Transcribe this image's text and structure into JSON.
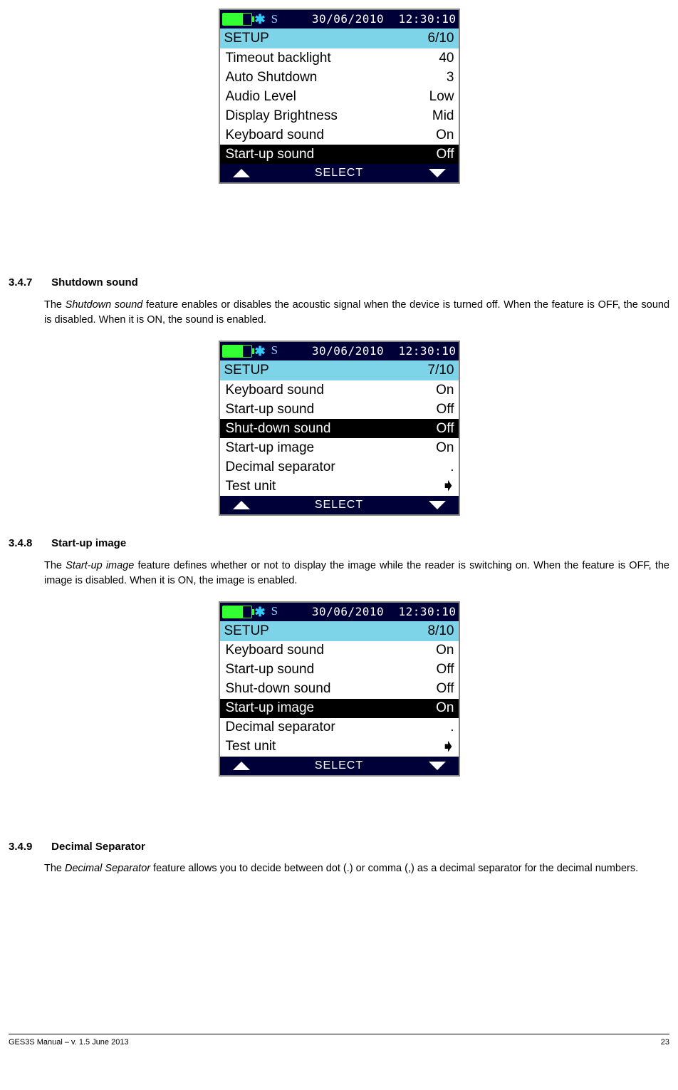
{
  "device_common": {
    "date": "30/06/2010",
    "time": "12:30:10",
    "setup_label": "SETUP",
    "select_label": "SELECT",
    "signal_letter": "S"
  },
  "screen1": {
    "page_indicator": "6/10",
    "rows": [
      {
        "label": "Timeout backlight",
        "value": "40",
        "selected": false
      },
      {
        "label": "Auto Shutdown",
        "value": "3",
        "selected": false
      },
      {
        "label": "Audio Level",
        "value": "Low",
        "selected": false
      },
      {
        "label": "Display Brightness",
        "value": "Mid",
        "selected": false
      },
      {
        "label": "Keyboard sound",
        "value": "On",
        "selected": false
      },
      {
        "label": "Start-up sound",
        "value": "Off",
        "selected": true
      }
    ]
  },
  "screen2": {
    "page_indicator": "7/10",
    "rows": [
      {
        "label": "Keyboard sound",
        "value": "On",
        "selected": false
      },
      {
        "label": "Start-up sound",
        "value": "Off",
        "selected": false
      },
      {
        "label": "Shut-down sound",
        "value": "Off",
        "selected": true
      },
      {
        "label": "Start-up image",
        "value": "On",
        "selected": false
      },
      {
        "label": "Decimal separator",
        "value": ".",
        "selected": false
      },
      {
        "label": "Test unit",
        "value": "➧",
        "selected": false,
        "arrow": true
      }
    ]
  },
  "screen3": {
    "page_indicator": "8/10",
    "rows": [
      {
        "label": "Keyboard sound",
        "value": "On",
        "selected": false
      },
      {
        "label": "Start-up sound",
        "value": "Off",
        "selected": false
      },
      {
        "label": "Shut-down sound",
        "value": "Off",
        "selected": false
      },
      {
        "label": "Start-up image",
        "value": "On",
        "selected": true
      },
      {
        "label": "Decimal separator",
        "value": ".",
        "selected": false
      },
      {
        "label": "Test unit",
        "value": "➧",
        "selected": false,
        "arrow": true
      }
    ]
  },
  "sections": {
    "s347": {
      "num": "3.4.7",
      "title": "Shutdown sound",
      "text_pre": "The ",
      "feat": "Shutdown sound",
      "text_post": " feature enables or disables the acoustic signal when the device is turned off. When the feature is OFF, the sound is disabled. When it is ON, the sound is enabled."
    },
    "s348": {
      "num": "3.4.8",
      "title": "Start-up image",
      "text_pre": "The ",
      "feat": "Start-up image",
      "text_post": " feature defines whether or not to display the image while the reader is switching on. When the feature is OFF, the image is disabled. When it is ON, the image is enabled."
    },
    "s349": {
      "num": "3.4.9",
      "title": "Decimal Separator",
      "text_pre": "The ",
      "feat": "Decimal Separator",
      "text_post": " feature allows you to decide between dot (.) or comma (,) as a decimal separator for the decimal numbers."
    }
  },
  "footer": {
    "left": "GES3S Manual – v. 1.5  June 2013",
    "right": "23"
  }
}
